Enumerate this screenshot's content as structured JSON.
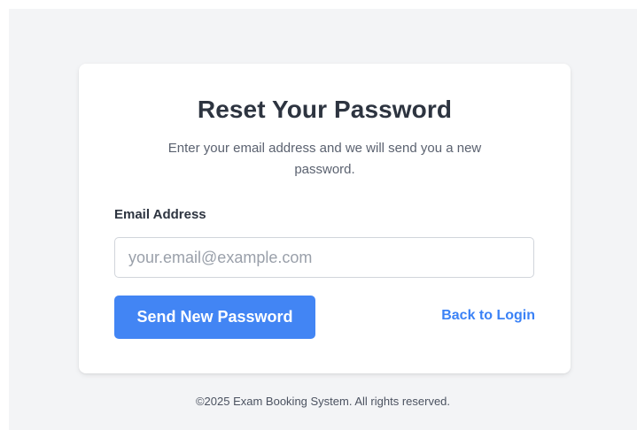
{
  "card": {
    "title": "Reset Your Password",
    "subtitle": "Enter your email address and we will send you a new password.",
    "email_label": "Email Address",
    "email_value": "",
    "email_placeholder": "your.email@example.com",
    "submit_label": "Send New Password",
    "back_link_label": "Back to Login"
  },
  "footer": {
    "text": "©2025 Exam Booking System. All rights reserved."
  },
  "colors": {
    "background": "#f3f4f6",
    "card": "#ffffff",
    "primary_button": "#4285f4",
    "link": "#3b82f6",
    "heading": "#2d3440"
  }
}
